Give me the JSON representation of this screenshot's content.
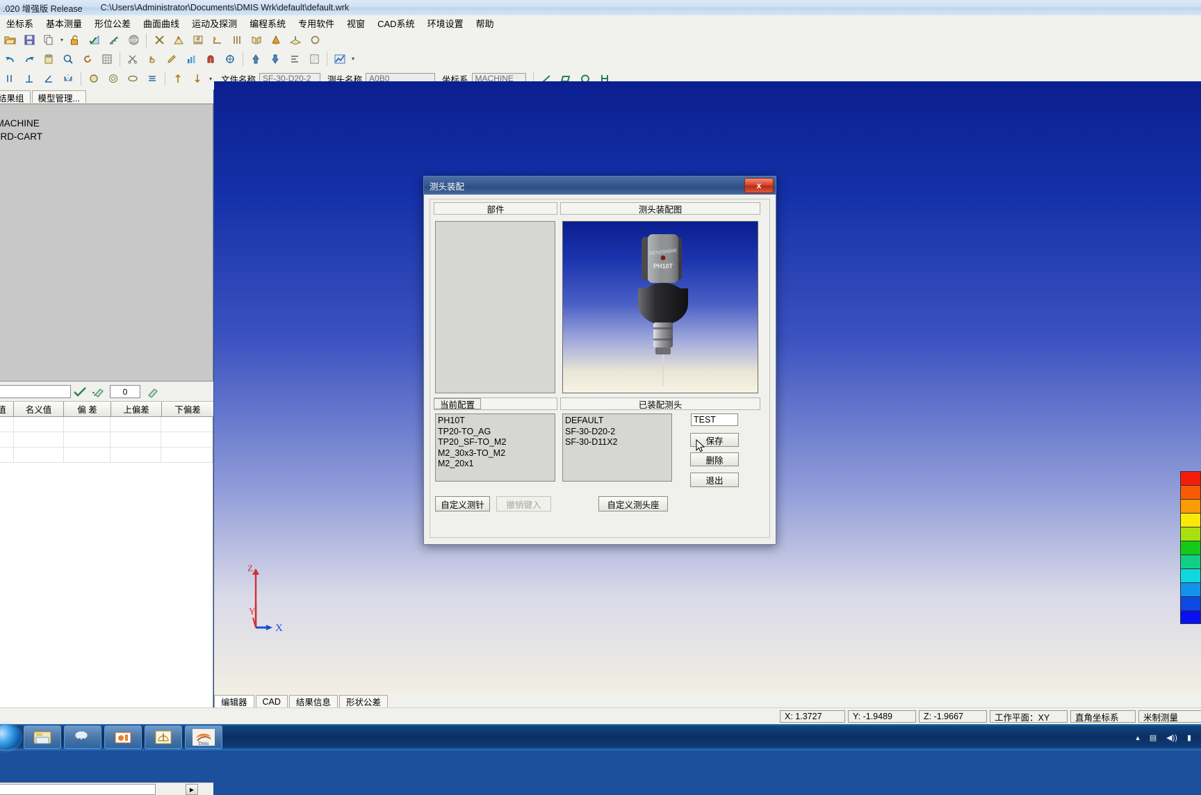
{
  "titlebar": {
    "version": ".020 增强版 Release",
    "path": "C:\\Users\\Administrator\\Documents\\DMIS Wrk\\default\\default.wrk"
  },
  "menubar": {
    "items": [
      {
        "label": "坐标系",
        "name": "menu-coordinate-system"
      },
      {
        "label": "基本测量",
        "name": "menu-basic-measure"
      },
      {
        "label": "形位公差",
        "name": "menu-geometric-tolerance"
      },
      {
        "label": "曲面曲线",
        "name": "menu-surface-curve"
      },
      {
        "label": "运动及探测",
        "name": "menu-motion-probing"
      },
      {
        "label": "编程系统",
        "name": "menu-programming"
      },
      {
        "label": "专用软件",
        "name": "menu-special-software"
      },
      {
        "label": "视窗",
        "name": "menu-window"
      },
      {
        "label": "CAD系统",
        "name": "menu-cad-system"
      },
      {
        "label": "环境设置",
        "name": "menu-environment"
      },
      {
        "label": "帮助",
        "name": "menu-help"
      }
    ]
  },
  "toolbar_row1": {
    "icons": [
      "open-folder-icon",
      "save-disk-icon",
      "copy-pages-icon",
      "dropdown-arrow-icon",
      "unlock-padlock-icon",
      "run-check-icon",
      "step-run-icon",
      "stop-sign-icon",
      "delete-cross-icon",
      "angle-theta-icon",
      "distance-d-icon",
      "corner-point-icon",
      "parallel-lines-icon",
      "mirror-planes-icon",
      "cone-icon",
      "plane-icon"
    ]
  },
  "toolbar_row2": {
    "icons": [
      "undo-arrow-icon",
      "redo-arrow-icon",
      "paste-icon",
      "search-circle-icon",
      "rotate-icon",
      "grid-icon",
      "scissors-icon",
      "pointer-hand-icon",
      "pencil-edit-icon",
      "chart-bar-icon",
      "magnet-icon",
      "target-cross-icon",
      "arrow-up-icon",
      "arrow-down-icon",
      "align-icon",
      "report-icon",
      "chart-line-icon",
      "dropdown-arrow-icon"
    ]
  },
  "toolbar_row3": {
    "icons": [
      "parallel-icon",
      "perpendicular-icon",
      "angle-icon",
      "symmetry-icon",
      "circle-icon",
      "concentric-icon",
      "ellipse-icon",
      "align-center-icon",
      "vector-up-icon",
      "vector-down-icon",
      "dropdown-arrow-icon",
      "line-icon",
      "rect-icon",
      "circle-shape-icon",
      "h-shape-icon"
    ],
    "file_name_label": "文件名称",
    "file_name_value": "SF-30-D20-2",
    "probe_name_label": "测头名称",
    "probe_name_value": "A0B0",
    "coord_label": "坐标系",
    "coord_value": "MACHINE"
  },
  "left_panel": {
    "tabs": [
      {
        "label": "结果组",
        "name": "tab-result-group"
      },
      {
        "label": "模型管理...",
        "name": "tab-model-management"
      }
    ],
    "tree_items": [
      {
        "label": "-MACHINE",
        "selected": false
      },
      {
        "label": "ORD-CART",
        "selected": true
      }
    ],
    "mid_toolbar": {
      "input_value": "",
      "check_icon": "check-mark-icon",
      "eraser_icon": "eraser-icon",
      "number_value": "0",
      "pencil_icon": "pencil-icon"
    },
    "grid_headers": [
      "值",
      "名义值",
      "偏 差",
      "上偏差",
      "下偏差"
    ],
    "grid_rows": []
  },
  "viewport": {
    "axis_labels": {
      "z": "Z",
      "y": "Y",
      "x": "X"
    },
    "legend_colors": [
      "#f41d09",
      "#f95a07",
      "#fb9b08",
      "#fbe80b",
      "#a9e010",
      "#14c918",
      "#11cf87",
      "#10d7de",
      "#1293ea",
      "#0e49e4",
      "#0910f0"
    ]
  },
  "bottom_tabs": [
    {
      "label": "编辑器",
      "name": "tab-editor",
      "active": true
    },
    {
      "label": "CAD",
      "name": "tab-cad",
      "active": false
    },
    {
      "label": "结果信息",
      "name": "tab-result-info",
      "active": false
    },
    {
      "label": "形状公差",
      "name": "tab-form-tolerance",
      "active": false
    }
  ],
  "statusbar": {
    "x": "X: 1.3727",
    "y": "Y: -1.9489",
    "z": "Z: -1.9667",
    "work_plane": "工作平面：XY",
    "coord_type": "直角坐标系",
    "unit": "米制测量"
  },
  "taskbar": {
    "start_icon": "windows-start-orb-icon",
    "buttons": [
      {
        "name": "taskbar-explorer",
        "icon": "folder-icon"
      },
      {
        "name": "taskbar-media",
        "icon": "scissors-icon"
      },
      {
        "name": "taskbar-camera",
        "icon": "camera-icon"
      },
      {
        "name": "taskbar-gauge",
        "icon": "gauge-icon"
      },
      {
        "name": "taskbar-dmis",
        "icon": "dmis-app-icon",
        "label": "Dmis"
      }
    ],
    "tray": [
      "show-desktop-icon",
      "network-icon",
      "volume-icon",
      "clock-icon"
    ]
  },
  "dialog": {
    "title": "测头装配",
    "close_label": "x",
    "group_parts": "部件",
    "group_diagram": "测头装配图",
    "parts_items": [],
    "diagram_alt": "renishaw-ph10t-probe-render",
    "current_config_label": "当前配置",
    "current_config_items": [
      "PH10T",
      "TP20-TO_AG",
      "TP20_SF-TO_M2",
      "M2_30x3-TO_M2",
      "M2_20x1"
    ],
    "assembled_label": "已装配测头",
    "assembled_items": [
      "DEFAULT",
      "SF-30-D20-2",
      "SF-30-D11X2"
    ],
    "name_input_value": "TEST",
    "save_label": "保存",
    "delete_label": "删除",
    "exit_label": "退出",
    "custom_stylus_label": "自定义测针",
    "undo_input_label": "撤销键入",
    "custom_head_label": "自定义测头座"
  }
}
